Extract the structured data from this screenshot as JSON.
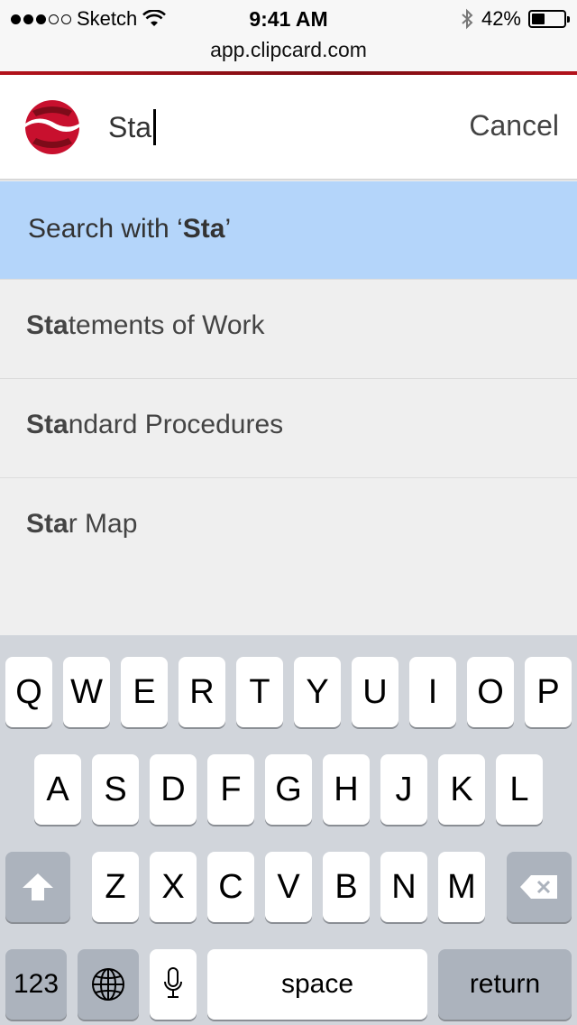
{
  "status_bar": {
    "carrier": "Sketch",
    "time": "9:41 AM",
    "battery_text": "42%",
    "battery_level": 0.42,
    "signal_bars": 3,
    "signal_total": 5
  },
  "url": "app.clipcard.com",
  "search": {
    "query": "Sta",
    "cancel_label": "Cancel"
  },
  "search_with": {
    "prefix": "Search with ‘",
    "term": "Sta",
    "suffix": "’"
  },
  "suggestions": [
    {
      "match": "Sta",
      "rest": "tements of Work"
    },
    {
      "match": "Sta",
      "rest": "ndard Procedures"
    },
    {
      "match": "Sta",
      "rest": "r Map"
    }
  ],
  "keyboard": {
    "row1": [
      "Q",
      "W",
      "E",
      "R",
      "T",
      "Y",
      "U",
      "I",
      "O",
      "P"
    ],
    "row2": [
      "A",
      "S",
      "D",
      "F",
      "G",
      "H",
      "J",
      "K",
      "L"
    ],
    "row3": [
      "Z",
      "X",
      "C",
      "V",
      "B",
      "N",
      "M"
    ],
    "numbers_label": "123",
    "space_label": "space",
    "return_label": "return"
  },
  "colors": {
    "brand_red": "#c8102e",
    "highlight_blue": "#b4d5fa"
  }
}
